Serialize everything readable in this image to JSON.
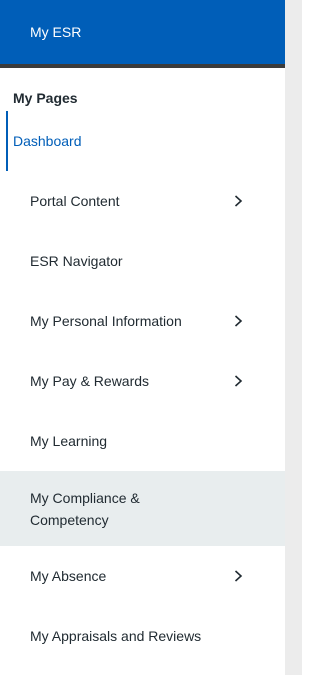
{
  "header": {
    "title": "My ESR"
  },
  "section": {
    "title": "My Pages"
  },
  "nav": {
    "dashboard": "Dashboard",
    "items": [
      {
        "label": "Portal Content",
        "has_submenu": true
      },
      {
        "label": "ESR Navigator",
        "has_submenu": false
      },
      {
        "label": "My Personal Information",
        "has_submenu": true
      },
      {
        "label": "My Pay & Rewards",
        "has_submenu": true
      },
      {
        "label": "My Learning",
        "has_submenu": false
      },
      {
        "label": "My Compliance & Competency",
        "has_submenu": false,
        "highlighted": true
      },
      {
        "label": "My Absence",
        "has_submenu": true
      },
      {
        "label": "My Appraisals and Reviews",
        "has_submenu": false
      }
    ]
  },
  "icons": {
    "submenu": "chevron-right-icon"
  },
  "colors": {
    "header_bg": "#005eb8",
    "active_text": "#005eb8",
    "highlight_bg": "#e8edee",
    "text": "#212b32"
  }
}
